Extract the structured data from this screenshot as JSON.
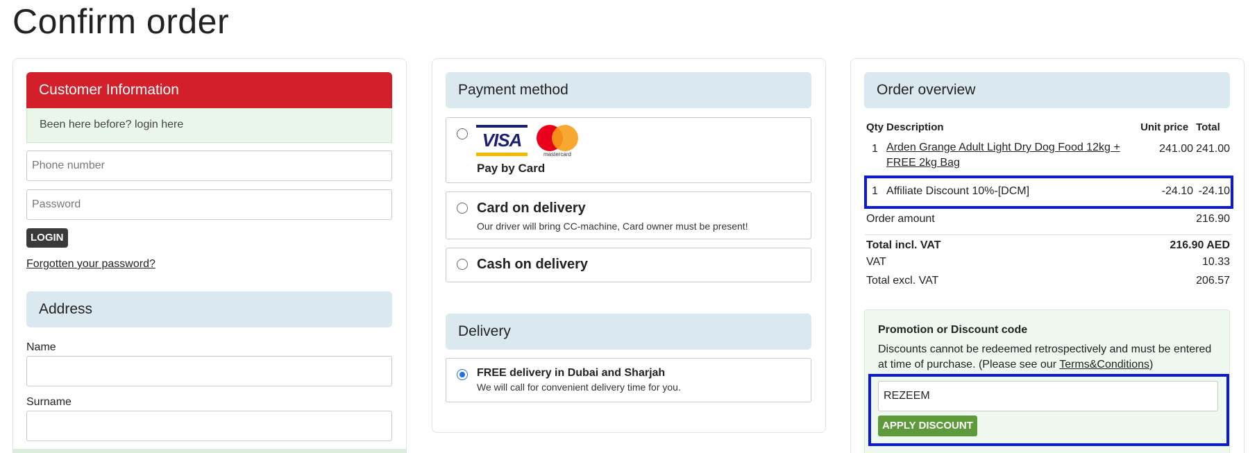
{
  "page": {
    "title": "Confirm order"
  },
  "customer": {
    "header": "Customer Information",
    "login_hint": "Been here before? login here",
    "phone_placeholder": "Phone number",
    "password_placeholder": "Password",
    "login_button": "LOGIN",
    "forgot_link": "Forgotten your password?"
  },
  "address": {
    "header": "Address",
    "name_label": "Name",
    "surname_label": "Surname"
  },
  "payment": {
    "header": "Payment method",
    "options": [
      {
        "label": "Pay by Card",
        "sub": "",
        "logos": [
          "visa-logo",
          "mastercard-logo"
        ],
        "visa_text": "VISA",
        "mc_text": "mastercard",
        "selected": false
      },
      {
        "label": "Card on delivery",
        "sub": "Our driver will bring CC-machine, Card owner must be present!",
        "selected": false
      },
      {
        "label": "Cash on delivery",
        "sub": "",
        "selected": false
      }
    ]
  },
  "delivery": {
    "header": "Delivery",
    "option": {
      "label": "FREE delivery in Dubai and Sharjah",
      "sub": "We will call for convenient delivery time for you.",
      "selected": true
    }
  },
  "overview": {
    "header": "Order overview",
    "columns": {
      "qty": "Qty",
      "description": "Description",
      "unit_price": "Unit price",
      "total": "Total"
    },
    "items": [
      {
        "qty": "1",
        "description": "Arden Grange Adult Light Dry Dog Food 12kg + FREE 2kg Bag",
        "unit_price": "241.00",
        "total": "241.00",
        "link": true
      },
      {
        "qty": "1",
        "description": "Affiliate Discount 10%-[DCM]",
        "unit_price": "-24.10",
        "total": "-24.10",
        "link": false
      }
    ],
    "order_amount_label": "Order amount",
    "order_amount": "216.90",
    "total_incl_label": "Total incl. VAT",
    "total_incl": "216.90 AED",
    "vat_label": "VAT",
    "vat": "10.33",
    "total_excl_label": "Total excl. VAT",
    "total_excl": "206.57"
  },
  "promo": {
    "title": "Promotion or Discount code",
    "text": "Discounts cannot be redeemed retrospectively and must be entered at time of purchase. (Please see our ",
    "terms_link": "Terms&Conditions",
    "text_end": ")",
    "code_value": "REZEEM",
    "apply_button": "APPLY DISCOUNT"
  },
  "colors": {
    "customer_header": "#d21f2a",
    "section_header": "#dae9ef",
    "highlight": "#0a1ad8",
    "apply_button": "#5e9a3c"
  }
}
